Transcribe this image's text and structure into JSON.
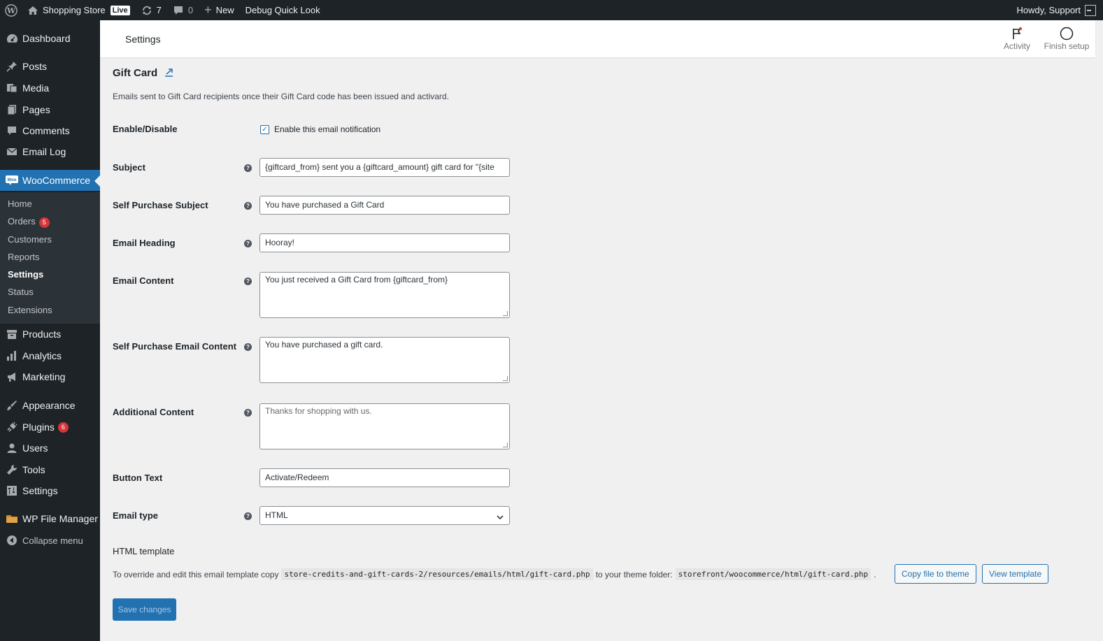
{
  "adminbar": {
    "wp_logo": "wordpress-icon",
    "site_name": "Shopping Store",
    "live_badge": "Live",
    "updates_count": "7",
    "comments_count": "0",
    "new_label": "New",
    "debug_label": "Debug Quick Look",
    "howdy": "Howdy, Support"
  },
  "sidebar": {
    "items": [
      {
        "label": "Dashboard",
        "icon": "dashboard-icon"
      },
      {
        "label": "Posts",
        "icon": "pin-icon"
      },
      {
        "label": "Media",
        "icon": "media-icon"
      },
      {
        "label": "Pages",
        "icon": "pages-icon"
      },
      {
        "label": "Comments",
        "icon": "comment-icon"
      },
      {
        "label": "Email Log",
        "icon": "email-icon"
      },
      {
        "label": "WooCommerce",
        "icon": "woo-icon"
      },
      {
        "label": "Products",
        "icon": "archive-icon"
      },
      {
        "label": "Analytics",
        "icon": "bar-chart-icon"
      },
      {
        "label": "Marketing",
        "icon": "megaphone-icon"
      },
      {
        "label": "Appearance",
        "icon": "brush-icon"
      },
      {
        "label": "Plugins",
        "icon": "plug-icon",
        "badge": "6"
      },
      {
        "label": "Users",
        "icon": "user-icon"
      },
      {
        "label": "Tools",
        "icon": "wrench-icon"
      },
      {
        "label": "Settings",
        "icon": "settings-icon"
      },
      {
        "label": "WP File Manager",
        "icon": "folder-icon"
      },
      {
        "label": "Collapse menu",
        "icon": "collapse-icon"
      }
    ],
    "submenu": [
      {
        "label": "Home"
      },
      {
        "label": "Orders",
        "badge": "5"
      },
      {
        "label": "Customers"
      },
      {
        "label": "Reports"
      },
      {
        "label": "Settings"
      },
      {
        "label": "Status"
      },
      {
        "label": "Extensions"
      }
    ]
  },
  "header": {
    "title": "Settings",
    "activity": "Activity",
    "finish_setup": "Finish setup"
  },
  "form": {
    "section_title": "Gift Card",
    "description": "Emails sent to Gift Card recipients once their Gift Card code has been issued and activard.",
    "enable_label": "Enable/Disable",
    "enable_checkbox_label": "Enable this email notification",
    "enabled": true,
    "subject_label": "Subject",
    "subject_value": "{giftcard_from} sent you a {giftcard_amount} gift card for \"{site",
    "self_subject_label": "Self Purchase Subject",
    "self_subject_value": "You have purchased a Gift Card",
    "heading_label": "Email Heading",
    "heading_value": "Hooray!",
    "content_label": "Email Content",
    "content_value": "You just received a Gift Card from {giftcard_from}",
    "self_content_label": "Self Purchase Email Content",
    "self_content_value": "You have purchased a gift card.",
    "additional_label": "Additional Content",
    "additional_placeholder": "Thanks for shopping with us.",
    "button_text_label": "Button Text",
    "button_text_value": "Activate/Redeem",
    "email_type_label": "Email type",
    "email_type_value": "HTML",
    "template_title": "HTML template",
    "template_text_1": "To override and edit this email template copy",
    "template_path": "store-credits-and-gift-cards-2/resources/emails/html/gift-card.php",
    "template_text_2": "to your theme folder:",
    "theme_path": "storefront/woocommerce/html/gift-card.php",
    "template_text_3": ".",
    "copy_button": "Copy file to theme",
    "view_button": "View template",
    "save_button": "Save changes"
  }
}
